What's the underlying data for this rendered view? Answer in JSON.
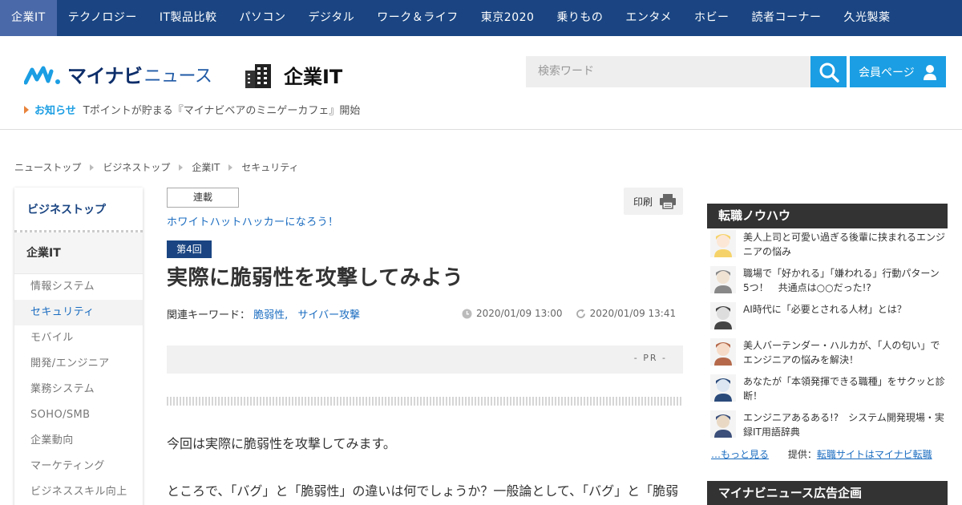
{
  "nav": [
    {
      "label": "企業IT",
      "active": true
    },
    {
      "label": "テクノロジー"
    },
    {
      "label": "IT製品比較"
    },
    {
      "label": "パソコン"
    },
    {
      "label": "デジタル"
    },
    {
      "label": "ワーク＆ライフ"
    },
    {
      "label": "東京2020"
    },
    {
      "label": "乗りもの"
    },
    {
      "label": "エンタメ"
    },
    {
      "label": "ホビー"
    },
    {
      "label": "読者コーナー"
    },
    {
      "label": "久光製薬"
    }
  ],
  "header": {
    "brand": "マイナビ",
    "brand_suffix": "ニュース",
    "section_title": "企業IT",
    "search_placeholder": "検索ワード",
    "member_label": "会員ページ"
  },
  "notice": {
    "label": "お知らせ",
    "text": "Tポイントが貯まる『マイナビベアのミニゲーカフェ』開始"
  },
  "breadcrumb": [
    "ニューストップ",
    "ビジネストップ",
    "企業IT",
    "セキュリティ"
  ],
  "sidebar": {
    "top": "ビジネストップ",
    "category": "企業IT",
    "items": [
      {
        "label": "情報システム"
      },
      {
        "label": "セキュリティ",
        "active": true
      },
      {
        "label": "モバイル"
      },
      {
        "label": "開発/エンジニア"
      },
      {
        "label": "業務システム"
      },
      {
        "label": "SOHO/SMB"
      },
      {
        "label": "企業動向"
      },
      {
        "label": "マーケティング"
      },
      {
        "label": "ビジネススキル向上"
      }
    ]
  },
  "article": {
    "series_tag": "連載",
    "series_title": "ホワイトハットハッカーになろう！",
    "print_label": "印刷",
    "episode": "第4回",
    "headline": "実際に脆弱性を攻撃してみよう",
    "keywords_label": "関連キーワード：",
    "keywords": [
      "脆弱性,",
      "サイバー攻撃"
    ],
    "published": "2020/01/09 13:00",
    "updated": "2020/01/09 13:41",
    "pr_label": "- PR -",
    "paragraph1": "今回は実際に脆弱性を攻撃してみます。",
    "paragraph2": "ところで、「バグ」と「脆弱性」の違いは何でしょうか？一般論として、「バグ」と「脆弱性」の違いは何でしょうか？"
  },
  "right": {
    "section1_title": "転職ノウハウ",
    "items": [
      {
        "text": "美人上司と可愛い過ぎる後輩に挟まれるエンジニアの悩み",
        "icon": "anime-girl-blonde-icon"
      },
      {
        "text": "職場で「好かれる」「嫌われる」行動パターン5つ！　共通点は○○だった!?",
        "icon": "office-man-icon"
      },
      {
        "text": "AI時代に「必要とされる人材」とは？",
        "icon": "ai-worker-icon"
      },
      {
        "text": "美人バーテンダー・ハルカが、「人の匂い」でエンジニアの悩みを解決！",
        "icon": "bartender-icon"
      },
      {
        "text": "あなたが「本領発揮できる職種」をサクッと診断！",
        "icon": "engineer-laptop-icon"
      },
      {
        "text": "エンジニアあるある!?　システム開発現場・実録IT用語辞典",
        "icon": "engineer-manga-icon"
      }
    ],
    "more_label": "…もっと見る",
    "provided_label": "提供：",
    "provided_link": "転職サイトはマイナビ転職",
    "section2_title": "マイナビニュース広告企画"
  },
  "colors": {
    "nav_bg": "#1a4582",
    "accent_blue": "#1b9ee3",
    "link": "#1a6cc0"
  }
}
